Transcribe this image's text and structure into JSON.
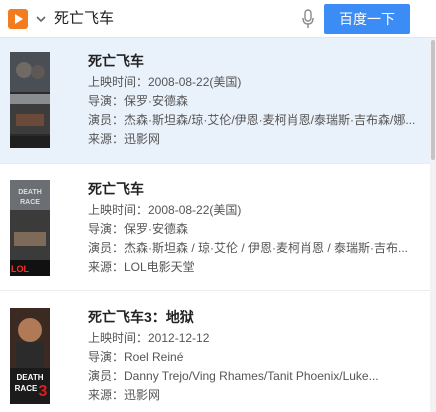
{
  "search": {
    "query": "死亡飞车",
    "button_label": "百度一下"
  },
  "results": [
    {
      "title": "死亡飞车",
      "release": "上映时间：2008-08-22(美国)",
      "director": "导演：保罗·安德森",
      "cast": "演员：杰森·斯坦森/琼·艾伦/伊恩·麦柯肖恩/泰瑞斯·吉布森/娜...",
      "source": "来源：迅影网",
      "selected": true
    },
    {
      "title": "死亡飞车",
      "release": "上映时间：2008-08-22(美国)",
      "director": "导演：保罗·安德森",
      "cast": "演员：杰森·斯坦森 / 琼·艾伦 / 伊恩·麦柯肖恩 / 泰瑞斯·吉布...",
      "source": "来源：LOL电影天堂",
      "poster_text": "LOL 电影天堂"
    },
    {
      "title": "死亡飞车3：地狱",
      "release": "上映时间：2012-12-12",
      "director": "导演：Roel Reiné",
      "cast": "演员：Danny Trejo/Ving Rhames/Tanit Phoenix/Luke...",
      "source": "来源：迅影网",
      "poster_text": "DEATH RACE 3"
    }
  ],
  "colors": {
    "accent": "#3b8cf5",
    "app_icon": "#f47c20",
    "selected_bg": "#e9f1fb"
  },
  "icons": [
    "video-app-icon",
    "chevron-down-icon",
    "microphone-icon"
  ]
}
